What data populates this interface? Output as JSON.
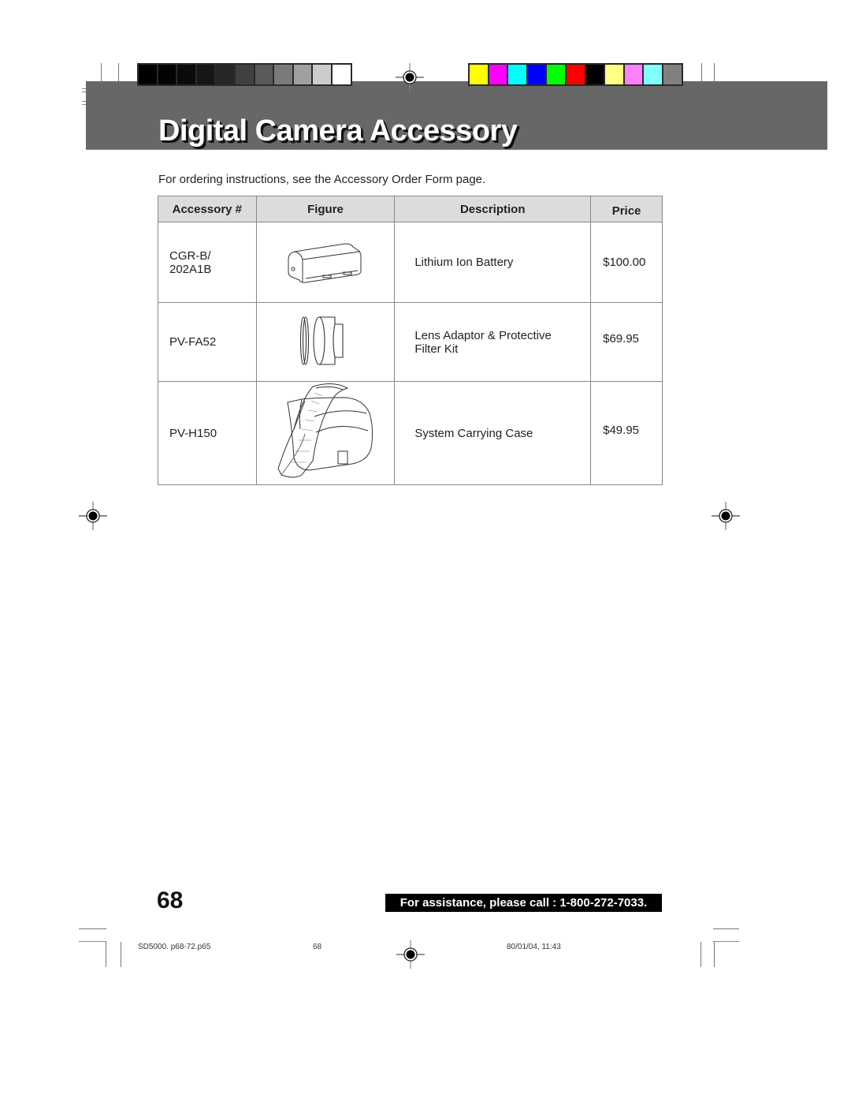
{
  "header": {
    "title": "Digital Camera Accessory"
  },
  "calibration": {
    "grayscale_swatches": [
      "#000000",
      "#030303",
      "#0b0b0b",
      "#161616",
      "#262626",
      "#404040",
      "#5a5a5a",
      "#7a7a7a",
      "#a0a0a0",
      "#cccccc",
      "#ffffff"
    ],
    "color_swatches": [
      "#ffff00",
      "#ff00ff",
      "#00ffff",
      "#0000ff",
      "#00ff00",
      "#ff0000",
      "#000000",
      "#ffff80",
      "#ff80ff",
      "#80ffff",
      "#808080"
    ]
  },
  "intro": "For ordering instructions, see the Accessory Order Form page.",
  "table": {
    "headers": [
      "Accessory #",
      "Figure",
      "Description",
      "Price"
    ],
    "rows": [
      {
        "code_line1": "CGR-B/",
        "code_line2": "202A1B",
        "figure": "battery-illustration",
        "desc_line1": "Lithium Ion Battery",
        "desc_line2": "",
        "price": "$100.00"
      },
      {
        "code_line1": "PV-FA52",
        "code_line2": "",
        "figure": "lens-adaptor-illustration",
        "desc_line1": "Lens Adaptor & Protective",
        "desc_line2": "Filter Kit",
        "price": "$69.95"
      },
      {
        "code_line1": "PV-H150",
        "code_line2": "",
        "figure": "carrying-case-illustration",
        "desc_line1": "System Carrying Case",
        "desc_line2": "",
        "price": "$49.95"
      }
    ]
  },
  "footer": {
    "page_number": "68",
    "assistance": "For assistance, please call : 1-800-272-7033.",
    "slug_file": "SD5000. p68-72.p65",
    "slug_page": "68",
    "slug_date": "80/01/04, 11:43"
  }
}
